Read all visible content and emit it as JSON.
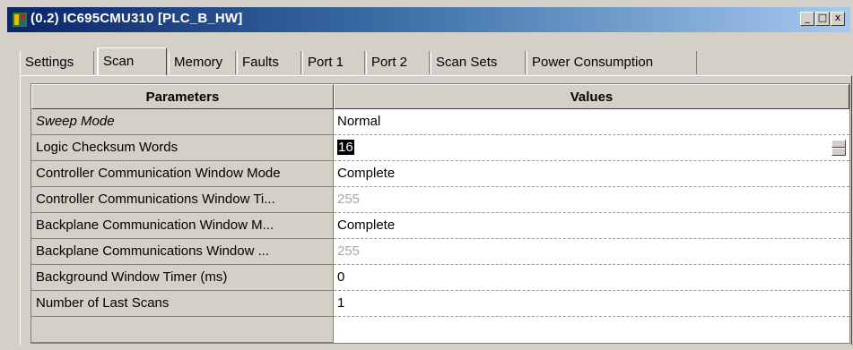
{
  "window": {
    "title": "(0.2) IC695CMU310 [PLC_B_HW]",
    "buttons": {
      "minimize": "_",
      "maximize": "□",
      "close": "x"
    }
  },
  "tabs": [
    {
      "label": "Settings",
      "active": false
    },
    {
      "label": "Scan",
      "active": true
    },
    {
      "label": "Memory",
      "active": false
    },
    {
      "label": "Faults",
      "active": false
    },
    {
      "label": "Port 1",
      "active": false
    },
    {
      "label": "Port 2",
      "active": false
    },
    {
      "label": "Scan Sets",
      "active": false
    },
    {
      "label": "Power Consumption",
      "active": false
    }
  ],
  "grid": {
    "headers": {
      "parameters": "Parameters",
      "values": "Values"
    },
    "rows": [
      {
        "param": "Sweep Mode",
        "value": "Normal",
        "italic": true,
        "disabled": false
      },
      {
        "param": "Logic Checksum Words",
        "value": "16",
        "selected": true,
        "disabled": false
      },
      {
        "param": "Controller Communication Window Mode",
        "value": "Complete",
        "disabled": false
      },
      {
        "param": "Controller Communications Window Ti...",
        "value": "255",
        "disabled": true
      },
      {
        "param": "Backplane Communication Window M...",
        "value": "Complete",
        "disabled": false
      },
      {
        "param": "Backplane Communications Window ...",
        "value": "255",
        "disabled": true
      },
      {
        "param": "Background Window Timer (ms)",
        "value": "0",
        "disabled": false
      },
      {
        "param": "Number of Last Scans",
        "value": "1",
        "disabled": false
      },
      {
        "param": "",
        "value": "",
        "disabled": false
      }
    ]
  },
  "colors": {
    "titlebar_start": "#0a246a",
    "titlebar_end": "#a6caf0",
    "face": "#d4d0c8",
    "disabled_text": "#a8a8a8"
  }
}
